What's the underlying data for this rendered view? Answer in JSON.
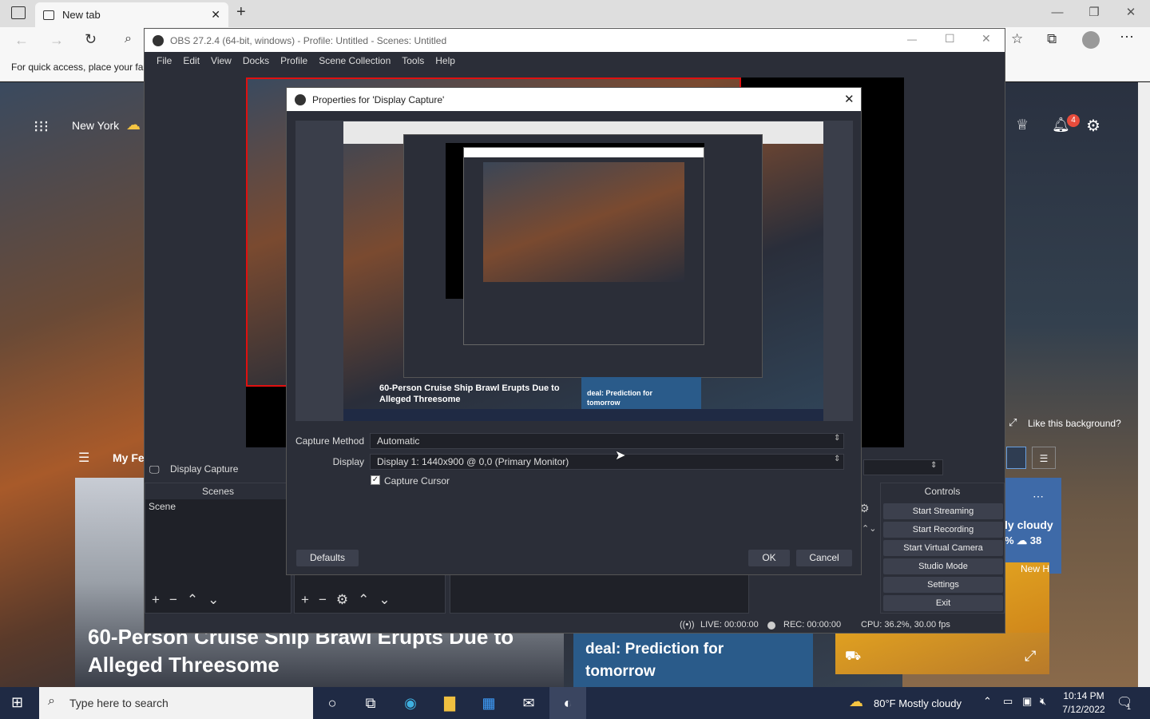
{
  "browser": {
    "tab_title": "New tab",
    "favbar_text": "For quick access, place your fa",
    "colors": {
      "accent": "#c50f1f"
    }
  },
  "ntp": {
    "location": "New York",
    "notifications": "4",
    "feed_label": "My Fe",
    "headline_1_line1": "60-Person Cruise Ship Brawl Erupts Due to",
    "headline_1_line2": "Alleged Threesome",
    "headline_2_line1": "deal: Prediction for",
    "headline_2_line2": "tomorrow",
    "bg_prompt": "Like this background?",
    "weather_partial_1": "ly cloudy",
    "weather_partial_2": "%  ☁ 38",
    "weather_new": "New H"
  },
  "obs": {
    "title": "OBS 27.2.4 (64-bit, windows) - Profile: Untitled - Scenes: Untitled",
    "menu": [
      "File",
      "Edit",
      "View",
      "Docks",
      "Profile",
      "Scene Collection",
      "Tools",
      "Help"
    ],
    "source_name": "Display Capture",
    "scenes_header": "Scenes",
    "scene_item": "Scene",
    "controls_header": "Controls",
    "controls": [
      "Start Streaming",
      "Start Recording",
      "Start Virtual Camera",
      "Studio Mode",
      "Settings",
      "Exit"
    ],
    "status": {
      "live": "LIVE: 00:00:00",
      "rec": "REC: 00:00:00",
      "cpu": "CPU: 36.2%, 30.00 fps"
    }
  },
  "dialog": {
    "title": "Properties for 'Display Capture'",
    "capture_method_label": "Capture Method",
    "capture_method_value": "Automatic",
    "display_label": "Display",
    "display_value": "Display 1: 1440x900 @ 0,0 (Primary Monitor)",
    "capture_cursor_label": "Capture Cursor",
    "capture_cursor_checked": true,
    "defaults_label": "Defaults",
    "ok_label": "OK",
    "cancel_label": "Cancel",
    "nested_headline_1": "60-Person Cruise Ship Brawl Erupts Due to",
    "nested_headline_2": "Alleged Threesome",
    "nested_deal_1": "deal: Prediction for",
    "nested_deal_2": "tomorrow"
  },
  "taskbar": {
    "search_placeholder": "Type here to search",
    "weather": "80°F  Mostly cloudy",
    "time": "10:14 PM",
    "date": "7/12/2022",
    "notif_count": "1"
  }
}
